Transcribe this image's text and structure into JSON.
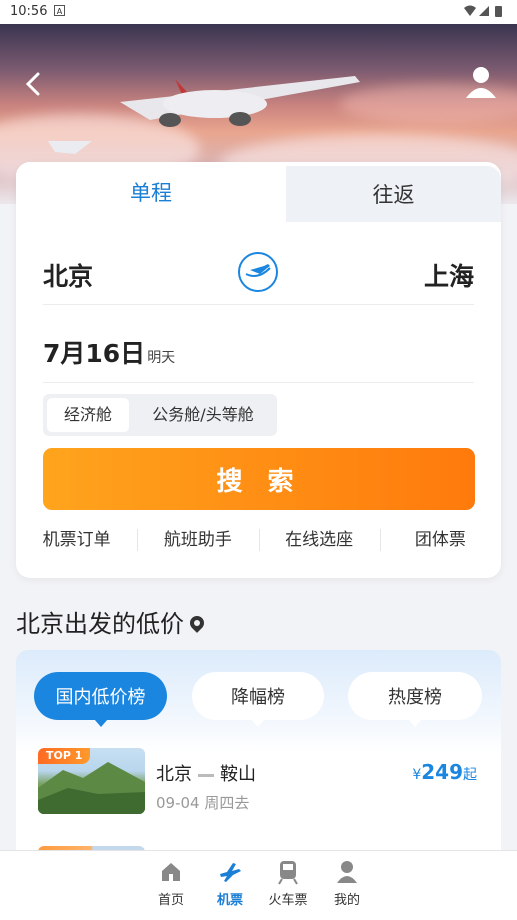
{
  "status_bar": {
    "time": "10:56",
    "notification_icon": "A"
  },
  "header": {
    "back_icon": "chevron-left-icon",
    "user_icon": "user-icon"
  },
  "search_card": {
    "tabs": [
      {
        "label": "单程",
        "active": true
      },
      {
        "label": "往返",
        "active": false
      }
    ],
    "from_city": "北京",
    "to_city": "上海",
    "date": "7月16日",
    "date_sub": "明天",
    "cabin_options": [
      "经济舱",
      "公务舱/头等舱"
    ],
    "search_label": "搜 索",
    "quick_links": [
      "机票订单",
      "航班助手",
      "在线选座",
      "团体票"
    ]
  },
  "low_price": {
    "title": "北京出发的低价",
    "tabs": [
      "国内低价榜",
      "降幅榜",
      "热度榜"
    ],
    "items": [
      {
        "badge": "TOP 1",
        "from": "北京",
        "to": "鞍山",
        "date": "09-04 周四去",
        "currency": "¥",
        "price": "249",
        "suffix": "起"
      }
    ]
  },
  "tab_bar": [
    {
      "label": "首页",
      "icon": "home-icon",
      "active": false
    },
    {
      "label": "机票",
      "icon": "plane-icon",
      "active": true
    },
    {
      "label": "火车票",
      "icon": "train-icon",
      "active": false
    },
    {
      "label": "我的",
      "icon": "profile-icon",
      "active": false
    }
  ],
  "colors": {
    "accent": "#1b86e0",
    "search_start": "#ffa41d",
    "search_end": "#ff7a0c"
  }
}
